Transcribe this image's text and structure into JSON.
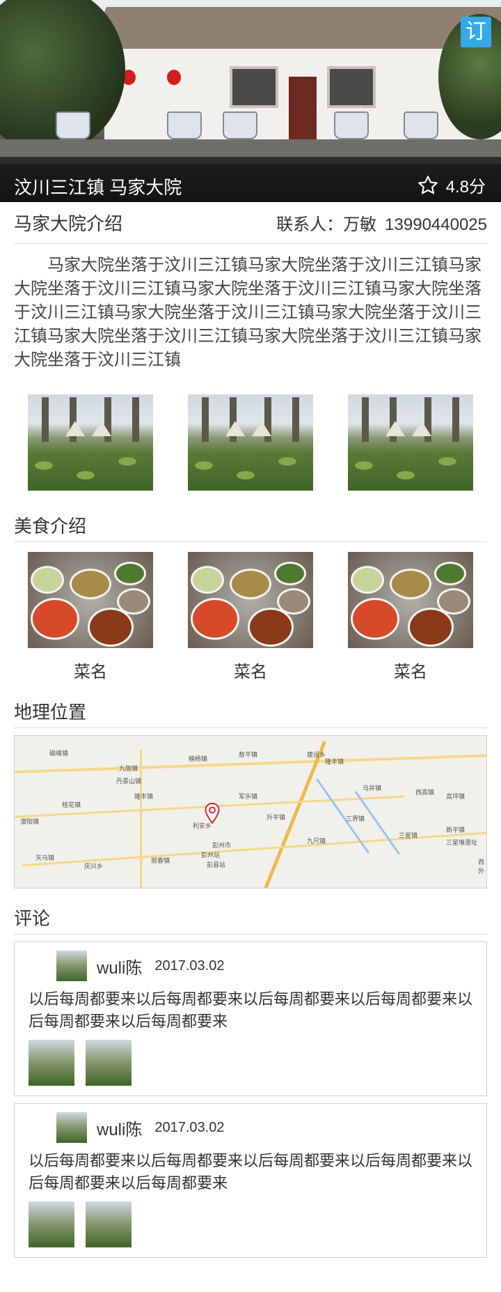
{
  "hero": {
    "title": "汶川三江镇 马家大院",
    "rating": "4.8分",
    "book_label": "订"
  },
  "intro": {
    "heading": "马家大院介绍",
    "contact_label": "联系人：万敏",
    "phone": "13990440025",
    "description": "马家大院坐落于汶川三江镇马家大院坐落于汶川三江镇马家大院坐落于汶川三江镇马家大院坐落于汶川三江镇马家大院坐落于汶川三江镇马家大院坐落于汶川三江镇马家大院坐落于汶川三江镇马家大院坐落于汶川三江镇马家大院坐落于汶川三江镇马家大院坐落于汶川三江镇"
  },
  "food": {
    "heading": "美食介绍",
    "items": [
      {
        "name": "菜名"
      },
      {
        "name": "菜名"
      },
      {
        "name": "菜名"
      }
    ]
  },
  "location": {
    "heading": "地理位置",
    "map_labels": [
      "磁峰镇",
      "九陇镇",
      "丹景山镇",
      "桂花镇",
      "隆丰镇",
      "楠杨镇",
      "敖平镇",
      "建设乡",
      "隆丰镇",
      "军乐镇",
      "升平镇",
      "马井镇",
      "西高镇",
      "高坪镇",
      "三界镇",
      "九尺镇",
      "三星镇",
      "新平镇",
      "利安乡",
      "彭州市",
      "彭州站",
      "丽春镇",
      "天马镇",
      "庆兴乡",
      "濛阳镇",
      "彭县站",
      "三星堆遗址",
      "西外"
    ]
  },
  "comments": {
    "heading": "评论",
    "items": [
      {
        "user": "wuli陈",
        "date": "2017.03.02",
        "text": "以后每周都要来以后每周都要来以后每周都要来以后每周都要来以后每周都要来以后每周都要来"
      },
      {
        "user": "wuli陈",
        "date": "2017.03.02",
        "text": "以后每周都要来以后每周都要来以后每周都要来以后每周都要来以后每周都要来以后每周都要来"
      }
    ]
  },
  "colors": {
    "accent": "#35a9e8",
    "pin": "#d9272e",
    "divider": "#dcdcdc"
  }
}
